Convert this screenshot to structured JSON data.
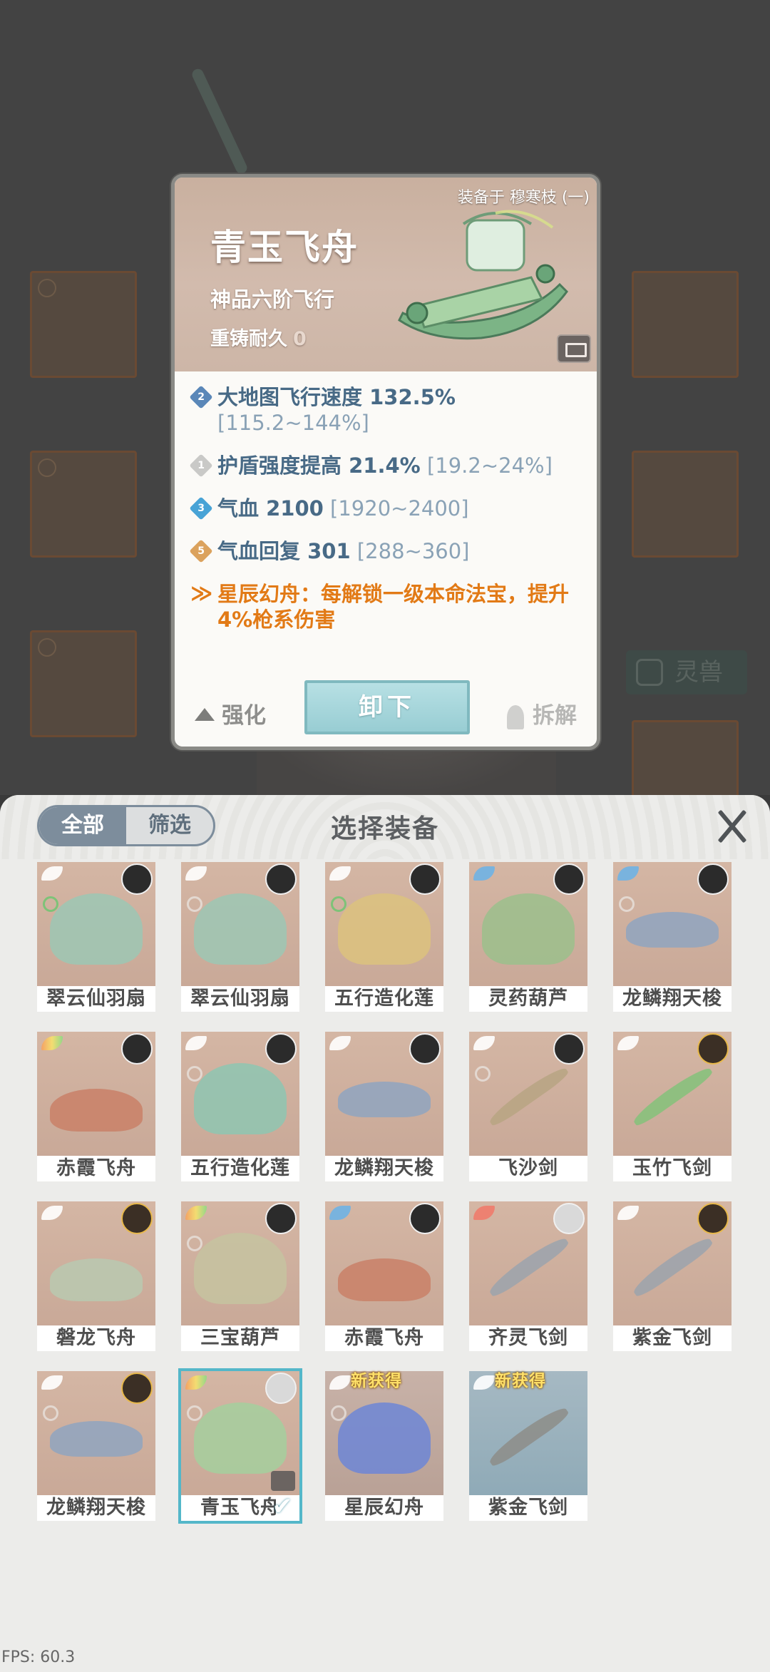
{
  "detail": {
    "equipped_on": "装备于 穆寒枝 (一)",
    "name": "青玉飞舟",
    "grade": "神品六阶飞行",
    "recast_label": "重铸耐久",
    "recast_value": "0",
    "stats": [
      {
        "badge": "2",
        "badge_color": "#5a87b8",
        "text": "大地图飞行速度 132.5%",
        "range": "[115.2~144%]"
      },
      {
        "badge": "1",
        "badge_color": "#c9c9c7",
        "text": "护盾强度提高 21.4%",
        "range": "[19.2~24%]"
      },
      {
        "badge": "3",
        "badge_color": "#48a3d6",
        "text": "气血 2100",
        "range": "[1920~2400]"
      },
      {
        "badge": "5",
        "badge_color": "#dba25d",
        "text": "气血回复 301",
        "range": "[288~360]"
      }
    ],
    "special": {
      "text": "星辰幻舟：每解锁一级本命法宝，提升4%枪系伤害"
    },
    "actions": {
      "upgrade": "强化",
      "unequip": "卸下",
      "dismantle": "拆解"
    }
  },
  "panel": {
    "title": "选择装备",
    "filter_all": "全部",
    "filter_screen": "筛选",
    "items": [
      {
        "label": "翠云仙羽扇"
      },
      {
        "label": "翠云仙羽扇"
      },
      {
        "label": "五行造化莲"
      },
      {
        "label": "灵药葫芦"
      },
      {
        "label": "龙鳞翔天梭"
      },
      {
        "label": "赤霞飞舟"
      },
      {
        "label": "五行造化莲"
      },
      {
        "label": "龙鳞翔天梭"
      },
      {
        "label": "飞沙剑"
      },
      {
        "label": "玉竹飞剑"
      },
      {
        "label": "磐龙飞舟"
      },
      {
        "label": "三宝葫芦"
      },
      {
        "label": "赤霞飞舟"
      },
      {
        "label": "齐灵飞剑"
      },
      {
        "label": "紫金飞剑"
      },
      {
        "label": "龙鳞翔天梭"
      },
      {
        "label": "青玉飞舟",
        "selected": true
      },
      {
        "label": "星辰幻舟",
        "new_tag": "新获得"
      },
      {
        "label": "紫金飞剑",
        "new_tag": "新获得"
      }
    ]
  },
  "bg": {
    "beast_label": "灵兽"
  },
  "fps": "FPS: 60.3"
}
